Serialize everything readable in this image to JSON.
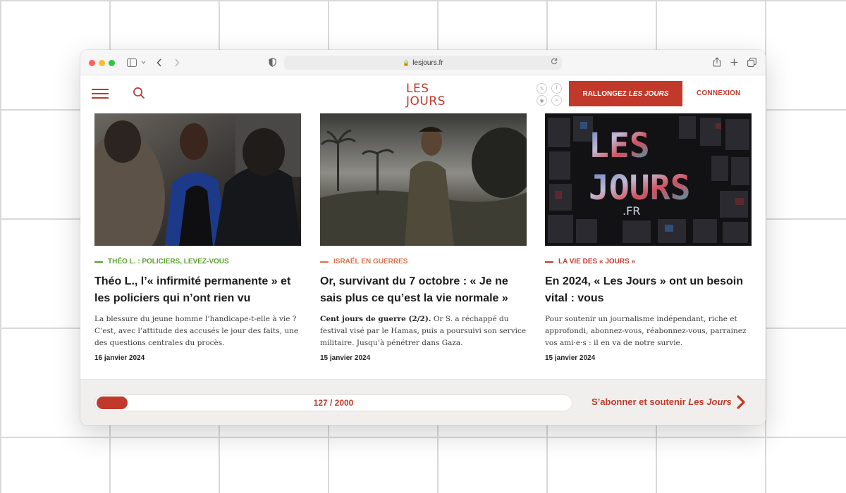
{
  "browser": {
    "url": "lesjours.fr",
    "share_icon": "share-icon",
    "new_tab_icon": "plus-icon",
    "tabs_icon": "tabs-overview-icon"
  },
  "header": {
    "logo_line1": "LES",
    "logo_line2": "JOURS",
    "social": [
      "x-icon",
      "facebook-icon",
      "instagram-icon",
      "rss-icon"
    ],
    "cta_label_prefix": "RALLONGEZ",
    "cta_label_italic": "LES JOURS",
    "login_label": "CONNEXION"
  },
  "articles": [
    {
      "kicker": "THÉO L. : POLICIERS, LEVEZ-VOUS",
      "kicker_color": "#5aa02c",
      "title": "Théo L., l’« infirmité permanente » et les policiers qui n’ont rien vu",
      "summary_lead": "",
      "summary": "La blessure du jeune homme l’handicape-t-elle à vie ? C’est, avec l’attitude des accusés le jour des faits, une des questions centrales du procès.",
      "date": "16 janvier 2024"
    },
    {
      "kicker": "ISRAËL EN GUERRES",
      "kicker_color": "#d9734a",
      "title": "Or, survivant du 7 octobre : « Je ne sais plus ce qu’est la vie normale »",
      "summary_lead": "Cent jours de guerre (2/2).",
      "summary": " Or S. a réchappé du festival visé par le Hamas, puis a poursuivi son service militaire. Jusqu’à pénétrer dans Gaza.",
      "date": "15 janvier 2024"
    },
    {
      "kicker": "LA VIE DES « JOURS »",
      "kicker_color": "#c0392b",
      "title": "En 2024, « Les Jours » ont un besoin vital : vous",
      "summary_lead": "",
      "summary": "Pour soutenir un journalisme indépendant, riche et approfondi, abonnez-vous, réabonnez-vous, parrainez vos ami·e·s : il en va de notre survie.",
      "date": "15 janvier 2024",
      "image_text_1": "LES",
      "image_text_2": "JOURS",
      "image_text_3": ".FR"
    }
  ],
  "subscription": {
    "progress_label": "127 / 2000",
    "progress_value": 127,
    "progress_goal": 2000,
    "cta_prefix": "S’abonner et soutenir",
    "cta_italic": "Les Jours"
  },
  "colors": {
    "accent": "#c0392b"
  }
}
